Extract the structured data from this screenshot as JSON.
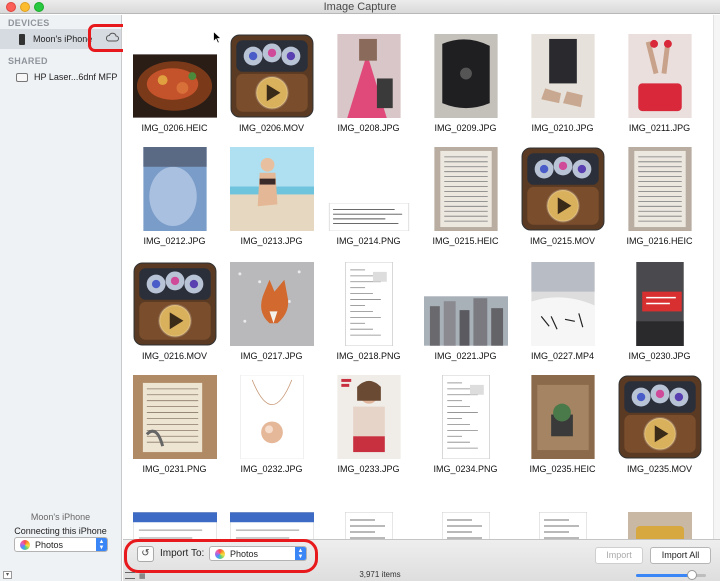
{
  "window": {
    "title": "Image Capture"
  },
  "sidebar": {
    "devices_header": "DEVICES",
    "device_name": "Moon's iPhone",
    "shared_header": "SHARED",
    "shared_device": "HP Laser...6dnf MFP",
    "bottom_device_name": "Moon's iPhone",
    "connect_label": "Connecting this iPhone opens:",
    "connect_app": "Photos"
  },
  "toolbar": {
    "import_to_label": "Import To:",
    "import_to_value": "Photos",
    "import_button": "Import",
    "import_all_button": "Import All",
    "items_count": "3,971 items",
    "thumbnail_size_percent": 80
  },
  "grid": {
    "items": [
      {
        "name": "IMG_0206.HEIC",
        "kind": "food"
      },
      {
        "name": "IMG_0206.MOV",
        "kind": "movie"
      },
      {
        "name": "IMG_0208.JPG",
        "kind": "fashion-pink"
      },
      {
        "name": "IMG_0209.JPG",
        "kind": "fashion-dark"
      },
      {
        "name": "IMG_0210.JPG",
        "kind": "fashion-shoes"
      },
      {
        "name": "IMG_0211.JPG",
        "kind": "fashion-red"
      },
      {
        "name": "IMG_0212.JPG",
        "kind": "belly-blue"
      },
      {
        "name": "IMG_0213.JPG",
        "kind": "beach"
      },
      {
        "name": "IMG_0214.PNG",
        "kind": "text-strip"
      },
      {
        "name": "IMG_0215.HEIC",
        "kind": "document-photo"
      },
      {
        "name": "IMG_0215.MOV",
        "kind": "movie"
      },
      {
        "name": "IMG_0216.HEIC",
        "kind": "document-photo"
      },
      {
        "name": "IMG_0216.MOV",
        "kind": "movie"
      },
      {
        "name": "IMG_0217.JPG",
        "kind": "fox"
      },
      {
        "name": "IMG_0218.PNG",
        "kind": "screenshot"
      },
      {
        "name": "IMG_0221.JPG",
        "kind": "city"
      },
      {
        "name": "IMG_0227.MP4",
        "kind": "snow"
      },
      {
        "name": "IMG_0230.JPG",
        "kind": "red-sign"
      },
      {
        "name": "IMG_0231.PNG",
        "kind": "book"
      },
      {
        "name": "IMG_0232.JPG",
        "kind": "pendant"
      },
      {
        "name": "IMG_0233.JPG",
        "kind": "model"
      },
      {
        "name": "IMG_0234.PNG",
        "kind": "screenshot"
      },
      {
        "name": "IMG_0235.HEIC",
        "kind": "plant"
      },
      {
        "name": "IMG_0235.MOV",
        "kind": "movie"
      },
      {
        "name": "",
        "kind": "web-blue"
      },
      {
        "name": "",
        "kind": "web-blue"
      },
      {
        "name": "",
        "kind": "text-page"
      },
      {
        "name": "",
        "kind": "text-page"
      },
      {
        "name": "",
        "kind": "text-page"
      },
      {
        "name": "",
        "kind": "chair"
      }
    ]
  },
  "colors": {
    "annotation": "#e8191c",
    "accent": "#3b86f6"
  }
}
